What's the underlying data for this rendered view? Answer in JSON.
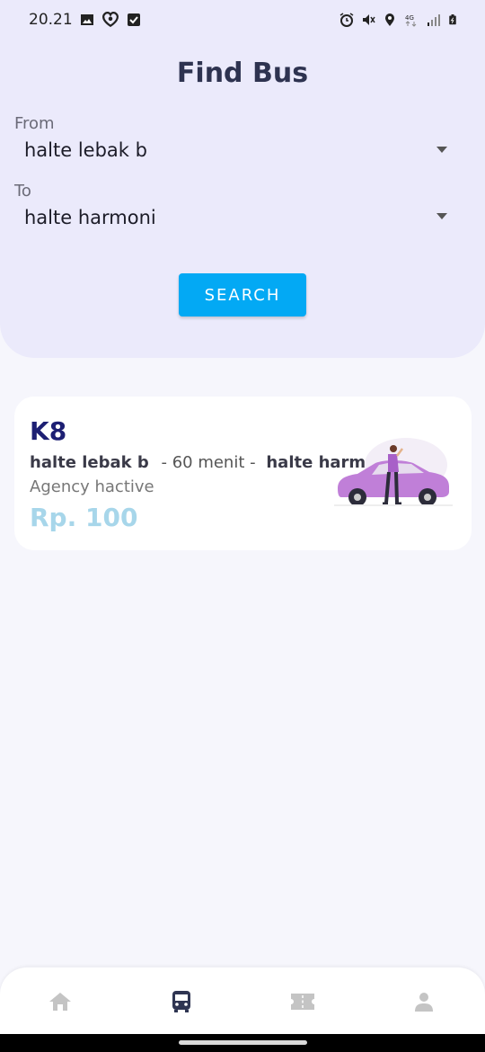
{
  "status_bar": {
    "time": "20.21",
    "left_icons": [
      "image-icon",
      "heart-icon",
      "checkbox-icon"
    ],
    "right_icons": [
      "alarm-icon",
      "mute-icon",
      "location-icon",
      "4g-icon",
      "signal-icon",
      "battery-icon"
    ]
  },
  "header": {
    "title": "Find Bus"
  },
  "form": {
    "from_label": "From",
    "from_value": "halte lebak b",
    "to_label": "To",
    "to_value": "halte harmoni",
    "search_label": "SEARCH"
  },
  "result": {
    "code": "K8",
    "origin": "halte lebak b",
    "duration": "- 60 menit -",
    "destination": "halte harmoni",
    "agency": "Agency hactive",
    "price": "Rp. 100"
  },
  "bottom_nav": {
    "items": [
      {
        "icon": "home-icon",
        "active": false
      },
      {
        "icon": "bus-icon",
        "active": true
      },
      {
        "icon": "ticket-icon",
        "active": false
      },
      {
        "icon": "profile-icon",
        "active": false
      }
    ]
  },
  "colors": {
    "header_bg": "#ebeafb",
    "page_bg": "#f6f6fc",
    "accent": "#03a9f4",
    "route_code": "#1d1f73",
    "price": "#a7d6ea",
    "nav_active": "#2f3552",
    "nav_inactive": "#c4c4c4"
  }
}
